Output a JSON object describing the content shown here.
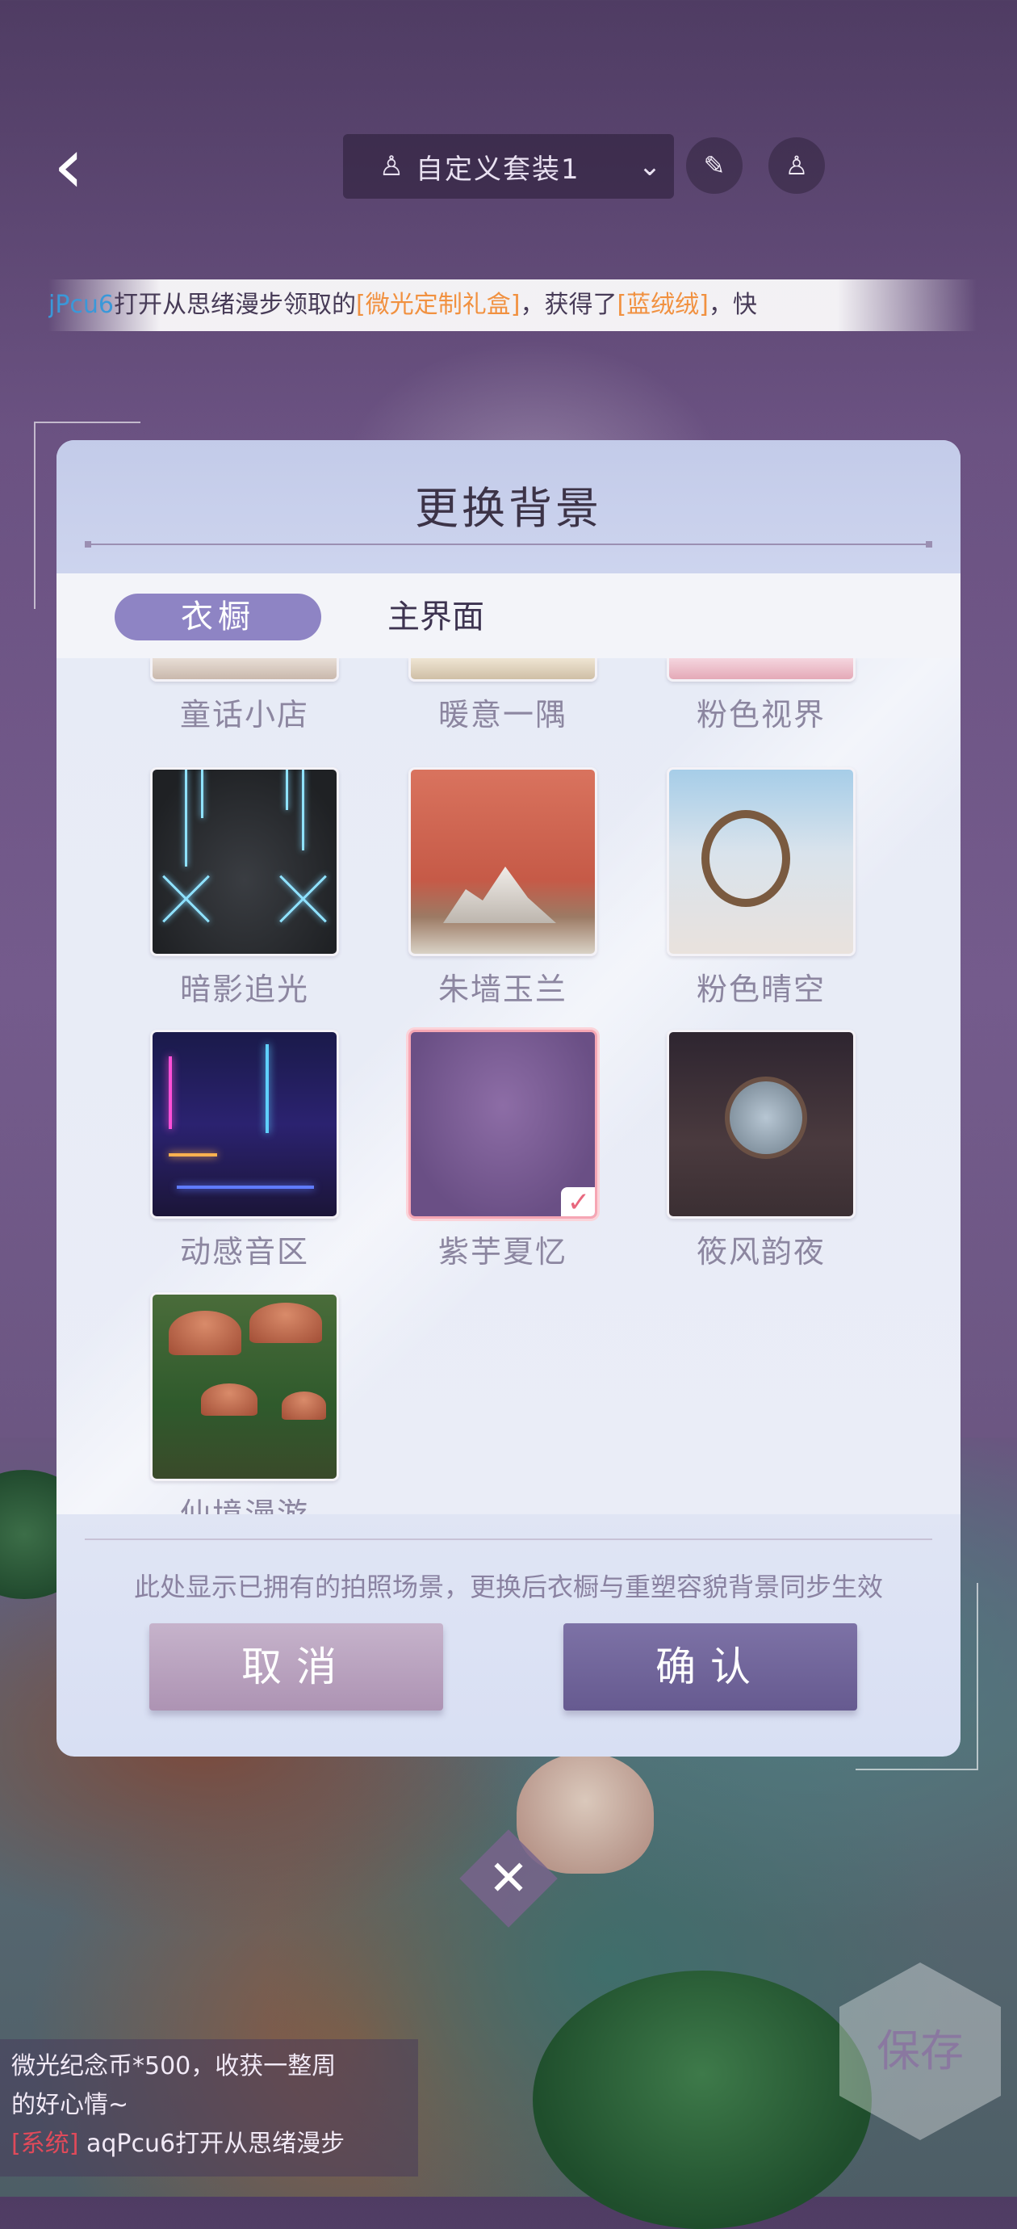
{
  "topbar": {
    "back": "‹",
    "suit_label": "自定义套装1",
    "suit_icon": "♙",
    "chevron": "⌄",
    "btn1": "✎",
    "btn2": "♙"
  },
  "marquee": {
    "user": "jPcu6",
    "t1": "打开从思绪漫步领取的",
    "gift": "[微光定制礼盒]",
    "t2": "，获得了",
    "item": "[蓝绒绒]",
    "t3": "，快"
  },
  "dialog": {
    "title": "更换背景",
    "tabs": [
      "衣橱",
      "主界面"
    ],
    "items": [
      {
        "label": "童话小店"
      },
      {
        "label": "暖意一隅"
      },
      {
        "label": "粉色视界"
      },
      {
        "label": "暗影追光"
      },
      {
        "label": "朱墙玉兰"
      },
      {
        "label": "粉色晴空"
      },
      {
        "label": "动感音区"
      },
      {
        "label": "紫芋夏忆",
        "selected": true
      },
      {
        "label": "筱风韵夜"
      },
      {
        "label": "仙境漫游"
      }
    ],
    "hint": "此处显示已拥有的拍照场景，更换后衣橱与重塑容貌背景同步生效",
    "cancel": "取消",
    "confirm": "确认",
    "check": "✓"
  },
  "close": "✕",
  "chat": {
    "line1": "微光纪念币*500，收获一整周",
    "line2": "的好心情~",
    "sys_tag": "[系统]",
    "line3": "aqPcu6打开从思绪漫步"
  },
  "save": "保存"
}
